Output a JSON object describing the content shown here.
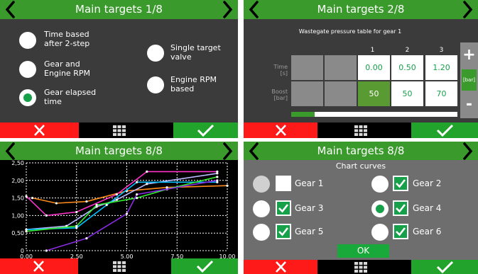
{
  "panel1": {
    "title": "Main targets 1/8",
    "options": [
      {
        "label": "Time based\nafter 2-step",
        "selected": false
      },
      {
        "label": "Gear and\nEngine RPM",
        "selected": false
      },
      {
        "label": "Gear elapsed\ntime",
        "selected": true
      },
      {
        "label": "Single target\nvalve",
        "selected": false
      },
      {
        "label": "Engine RPM\nbased",
        "selected": false
      }
    ]
  },
  "panel2": {
    "title": "Main targets 2/8",
    "subtitle": "Wastegate pressure table for gear 1",
    "columns": [
      "1",
      "2",
      "3"
    ],
    "row_time": {
      "label": "Time\n[s]",
      "values": [
        "0.00",
        "0.50",
        "1.20"
      ]
    },
    "row_boost": {
      "label": "Boost\n[bar]",
      "values": [
        "50",
        "50",
        "70"
      ]
    },
    "plus": "+",
    "minus": "-",
    "unit": "[bar]",
    "progress": 0.14
  },
  "panel3": {
    "title": "Main targets 8/8",
    "chart_data": {
      "type": "line",
      "xlim": [
        0,
        10
      ],
      "ylim": [
        0,
        2.5
      ],
      "x_ticks": [
        "0,00",
        "2,50",
        "5,00",
        "7,50",
        "10,00"
      ],
      "y_ticks": [
        "0",
        "0,50",
        "1,00",
        "1,50",
        "2,00",
        "2,50"
      ],
      "grid": true,
      "series": [
        {
          "color": "#ff8c1a",
          "points": [
            [
              0.3,
              1.5
            ],
            [
              1.5,
              1.35
            ],
            [
              3.0,
              1.4
            ],
            [
              5.0,
              1.7
            ],
            [
              7.0,
              1.8
            ],
            [
              10.0,
              1.85
            ]
          ]
        },
        {
          "color": "#ff33cc",
          "points": [
            [
              0.0,
              1.55
            ],
            [
              1.0,
              1.0
            ],
            [
              2.5,
              1.1
            ],
            [
              4.5,
              1.6
            ],
            [
              6.0,
              2.25
            ],
            [
              9.5,
              2.25
            ]
          ]
        },
        {
          "color": "#b8b8ff",
          "points": [
            [
              0.0,
              0.6
            ],
            [
              2.0,
              0.7
            ],
            [
              3.5,
              1.25
            ],
            [
              4.5,
              1.45
            ],
            [
              6.0,
              1.9
            ],
            [
              9.5,
              2.2
            ]
          ]
        },
        {
          "color": "#00bfff",
          "points": [
            [
              0.0,
              0.6
            ],
            [
              2.5,
              0.65
            ],
            [
              4.0,
              1.3
            ],
            [
              5.5,
              1.95
            ],
            [
              9.5,
              1.95
            ]
          ]
        },
        {
          "color": "#33ee33",
          "points": [
            [
              0.0,
              0.55
            ],
            [
              2.5,
              0.7
            ],
            [
              3.5,
              1.3
            ],
            [
              5.5,
              1.5
            ],
            [
              7.0,
              1.75
            ],
            [
              9.5,
              2.1
            ]
          ]
        },
        {
          "color": "#8a2be2",
          "points": [
            [
              1.0,
              0.0
            ],
            [
              3.0,
              0.35
            ],
            [
              5.0,
              1.05
            ],
            [
              5.5,
              1.6
            ],
            [
              9.5,
              2.0
            ]
          ]
        }
      ]
    }
  },
  "panel4": {
    "title": "Main targets 8/8",
    "subtitle": "Chart curves",
    "gears": [
      {
        "label": "Gear 1",
        "radio": "empty",
        "checked": false
      },
      {
        "label": "Gear 2",
        "radio": "white",
        "checked": true
      },
      {
        "label": "Gear 3",
        "radio": "white",
        "checked": true
      },
      {
        "label": "Gear 4",
        "radio": "selected",
        "checked": true
      },
      {
        "label": "Gear 5",
        "radio": "white",
        "checked": true
      },
      {
        "label": "Gear 6",
        "radio": "white",
        "checked": true
      }
    ],
    "ok": "OK"
  },
  "icons": {
    "prev": "chevron-left-icon",
    "next": "chevron-right-icon",
    "cancel": "x-icon",
    "menu": "grid-icon",
    "confirm": "check-icon"
  },
  "colors": {
    "header_green": "#3b9a2c",
    "cancel_red": "#ff1a1a",
    "confirm_green": "#22a32b",
    "panel_dark": "#3b3b3b",
    "panel_gray": "#6e6e6e"
  }
}
